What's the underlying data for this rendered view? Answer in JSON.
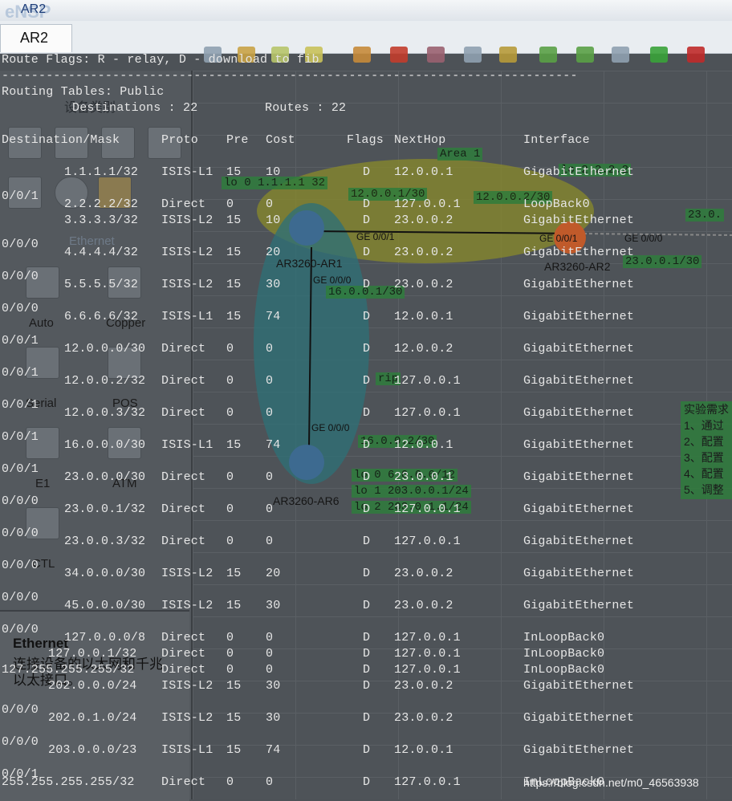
{
  "window": {
    "title": "AR2",
    "tab": "AR2",
    "app_logo": "eNSP"
  },
  "palette": {
    "title": "设备类别",
    "section": "Ethernet",
    "items": [
      "Auto",
      "Copper",
      "Serial",
      "POS",
      "E1",
      "ATM",
      "CTL"
    ],
    "desc_title": "Ethernet",
    "desc_text": "连接设备的以太网和千兆以太接口。"
  },
  "topology": {
    "area_label": "Area 1",
    "devices": [
      "AR3260-AR1",
      "AR3260-AR2",
      "AR3260-AR6"
    ],
    "labels": [
      "lo 0 1.1.1.1 32",
      "12.0.0.1/30",
      "12.0.0.2/30",
      "lo 2.2.2.2",
      "23.0.0.1/30",
      "23.0.",
      "16.0.0.1/30",
      "rip",
      "16.0.0.2/30",
      "lo 0 6.6.6.6/12",
      "lo 1 203.0.0.1/24",
      "lo 2 203.0.1.1/24"
    ],
    "ports": [
      "GE 0/0/1",
      "GE 0/0/1",
      "GE 0/0/0",
      "GE 0/0/0",
      "GE 0/0/0"
    ],
    "right_note": [
      "实验需求",
      "1、通过",
      "2、配置",
      "3、配置",
      "4、配置",
      "5、调整"
    ]
  },
  "terminal": {
    "flags_line": "Route Flags: R - relay, D - download to fib",
    "separator": "------------------------------------------------------------------------------",
    "tables_line": "Routing Tables: Public",
    "summary": {
      "destinations": "Destinations : 22",
      "routes": "Routes : 22"
    },
    "headers": {
      "dest": "Destination/Mask",
      "proto": "Proto",
      "pre": "Pre",
      "cost": "Cost",
      "flags": "Flags",
      "nexthop": "NextHop",
      "iface": "Interface"
    },
    "routes": [
      {
        "dest": "1.1.1.1/32",
        "proto": "ISIS-L1",
        "pre": "15",
        "cost": "10",
        "flag": "D",
        "nh": "12.0.0.1",
        "iface": "GigabitEthernet",
        "port": "0/0/1"
      },
      {
        "dest": "2.2.2.2/32",
        "proto": "Direct",
        "pre": "0",
        "cost": "0",
        "flag": "D",
        "nh": "127.0.0.1",
        "iface": "LoopBack0",
        "port": ""
      },
      {
        "dest": "3.3.3.3/32",
        "proto": "ISIS-L2",
        "pre": "15",
        "cost": "10",
        "flag": "D",
        "nh": "23.0.0.2",
        "iface": "GigabitEthernet",
        "port": "0/0/0"
      },
      {
        "dest": "4.4.4.4/32",
        "proto": "ISIS-L2",
        "pre": "15",
        "cost": "20",
        "flag": "D",
        "nh": "23.0.0.2",
        "iface": "GigabitEthernet",
        "port": "0/0/0"
      },
      {
        "dest": "5.5.5.5/32",
        "proto": "ISIS-L2",
        "pre": "15",
        "cost": "30",
        "flag": "D",
        "nh": "23.0.0.2",
        "iface": "GigabitEthernet",
        "port": "0/0/0"
      },
      {
        "dest": "6.6.6.6/32",
        "proto": "ISIS-L1",
        "pre": "15",
        "cost": "74",
        "flag": "D",
        "nh": "12.0.0.1",
        "iface": "GigabitEthernet",
        "port": "0/0/1"
      },
      {
        "dest": "12.0.0.0/30",
        "proto": "Direct",
        "pre": "0",
        "cost": "0",
        "flag": "D",
        "nh": "12.0.0.2",
        "iface": "GigabitEthernet",
        "port": "0/0/1"
      },
      {
        "dest": "12.0.0.2/32",
        "proto": "Direct",
        "pre": "0",
        "cost": "0",
        "flag": "D",
        "nh": "127.0.0.1",
        "iface": "GigabitEthernet",
        "port": "0/0/1"
      },
      {
        "dest": "12.0.0.3/32",
        "proto": "Direct",
        "pre": "0",
        "cost": "0",
        "flag": "D",
        "nh": "127.0.0.1",
        "iface": "GigabitEthernet",
        "port": "0/0/1"
      },
      {
        "dest": "16.0.0.0/30",
        "proto": "ISIS-L1",
        "pre": "15",
        "cost": "74",
        "flag": "D",
        "nh": "12.0.0.1",
        "iface": "GigabitEthernet",
        "port": "0/0/1"
      },
      {
        "dest": "23.0.0.0/30",
        "proto": "Direct",
        "pre": "0",
        "cost": "0",
        "flag": "D",
        "nh": "23.0.0.1",
        "iface": "GigabitEthernet",
        "port": "0/0/0"
      },
      {
        "dest": "23.0.0.1/32",
        "proto": "Direct",
        "pre": "0",
        "cost": "0",
        "flag": "D",
        "nh": "127.0.0.1",
        "iface": "GigabitEthernet",
        "port": "0/0/0"
      },
      {
        "dest": "23.0.0.3/32",
        "proto": "Direct",
        "pre": "0",
        "cost": "0",
        "flag": "D",
        "nh": "127.0.0.1",
        "iface": "GigabitEthernet",
        "port": "0/0/0"
      },
      {
        "dest": "34.0.0.0/30",
        "proto": "ISIS-L2",
        "pre": "15",
        "cost": "20",
        "flag": "D",
        "nh": "23.0.0.2",
        "iface": "GigabitEthernet",
        "port": "0/0/0"
      },
      {
        "dest": "45.0.0.0/30",
        "proto": "ISIS-L2",
        "pre": "15",
        "cost": "30",
        "flag": "D",
        "nh": "23.0.0.2",
        "iface": "GigabitEthernet",
        "port": "0/0/0"
      },
      {
        "dest": "127.0.0.0/8",
        "proto": "Direct",
        "pre": "0",
        "cost": "0",
        "flag": "D",
        "nh": "127.0.0.1",
        "iface": "InLoopBack0",
        "port": ""
      },
      {
        "dest": "127.0.0.1/32",
        "proto": "Direct",
        "pre": "0",
        "cost": "0",
        "flag": "D",
        "nh": "127.0.0.1",
        "iface": "InLoopBack0",
        "port": ""
      },
      {
        "dest": "127.255.255.255/32",
        "proto": "Direct",
        "pre": "0",
        "cost": "0",
        "flag": "D",
        "nh": "127.0.0.1",
        "iface": "InLoopBack0",
        "port": ""
      },
      {
        "dest": "202.0.0.0/24",
        "proto": "ISIS-L2",
        "pre": "15",
        "cost": "30",
        "flag": "D",
        "nh": "23.0.0.2",
        "iface": "GigabitEthernet",
        "port": "0/0/0"
      },
      {
        "dest": "202.0.1.0/24",
        "proto": "ISIS-L2",
        "pre": "15",
        "cost": "30",
        "flag": "D",
        "nh": "23.0.0.2",
        "iface": "GigabitEthernet",
        "port": "0/0/0"
      },
      {
        "dest": "203.0.0.0/23",
        "proto": "ISIS-L1",
        "pre": "15",
        "cost": "74",
        "flag": "D",
        "nh": "12.0.0.1",
        "iface": "GigabitEthernet",
        "port": "0/0/1"
      },
      {
        "dest": "255.255.255.255/32",
        "proto": "Direct",
        "pre": "0",
        "cost": "0",
        "flag": "D",
        "nh": "127.0.0.1",
        "iface": "InLoopBack0",
        "port": ""
      }
    ]
  },
  "watermark": "https://blog.csdn.net/m0_46563938"
}
